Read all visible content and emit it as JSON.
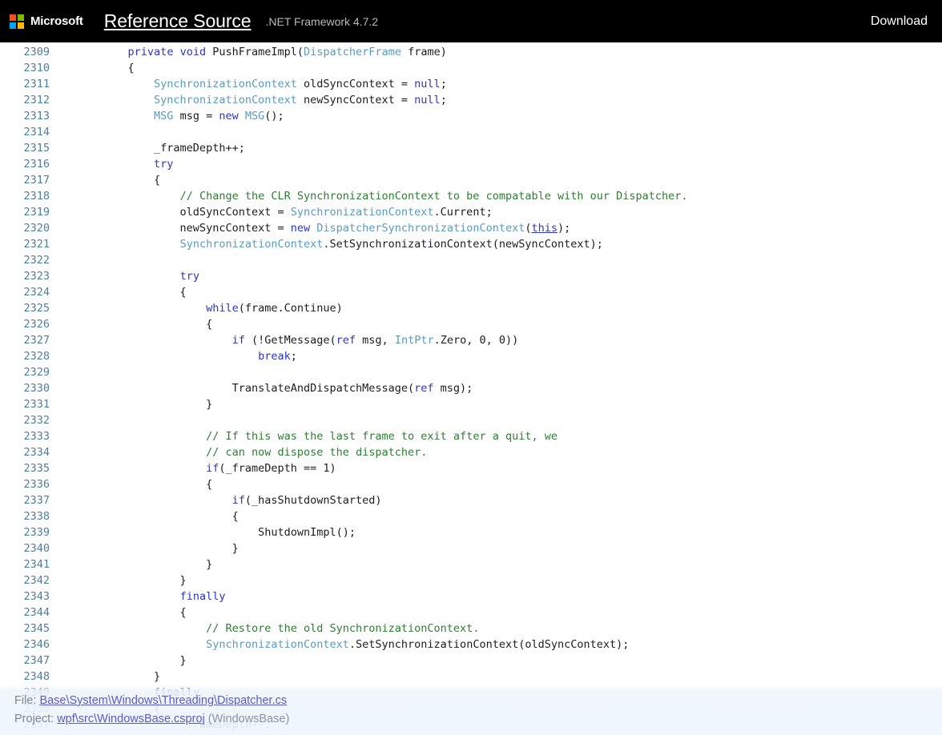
{
  "header": {
    "logo_icon": "microsoft-squares-icon",
    "wordmark": "Microsoft",
    "brand_title": "Reference Source",
    "framework_version": ".NET Framework 4.7.2",
    "download_label": "Download"
  },
  "colors": {
    "header_bg": "#000000",
    "page_bg": "#ffffff",
    "line_number": "#4a7fa0",
    "keyword": "#2b36c4",
    "type": "#5b9bbd",
    "comment": "#2e7d32",
    "plain_text": "#1c1c1c",
    "footer_bg": "#eff5fd",
    "footer_text": "#7d8590",
    "footer_link": "#5a5ad0",
    "ms_red": "#f25022",
    "ms_green": "#7fba00",
    "ms_blue": "#00a4ef",
    "ms_yellow": "#ffb900"
  },
  "code": {
    "language": "csharp",
    "first_line": 2309,
    "last_line": 2351,
    "lines": [
      {
        "n": "2309",
        "tokens": [
          {
            "s": "            ",
            "c": "n"
          },
          {
            "s": "private",
            "c": "k"
          },
          {
            "s": " ",
            "c": "n"
          },
          {
            "s": "void",
            "c": "k"
          },
          {
            "s": " PushFrameImpl(",
            "c": "n"
          },
          {
            "s": "DispatcherFrame",
            "c": "t"
          },
          {
            "s": " frame)",
            "c": "n"
          }
        ]
      },
      {
        "n": "2310",
        "tokens": [
          {
            "s": "            {",
            "c": "n"
          }
        ]
      },
      {
        "n": "2311",
        "tokens": [
          {
            "s": "                ",
            "c": "n"
          },
          {
            "s": "SynchronizationContext",
            "c": "t"
          },
          {
            "s": " oldSyncContext = ",
            "c": "n"
          },
          {
            "s": "null",
            "c": "k"
          },
          {
            "s": ";",
            "c": "n"
          }
        ]
      },
      {
        "n": "2312",
        "tokens": [
          {
            "s": "                ",
            "c": "n"
          },
          {
            "s": "SynchronizationContext",
            "c": "t"
          },
          {
            "s": " newSyncContext = ",
            "c": "n"
          },
          {
            "s": "null",
            "c": "k"
          },
          {
            "s": ";",
            "c": "n"
          }
        ]
      },
      {
        "n": "2313",
        "tokens": [
          {
            "s": "                ",
            "c": "n"
          },
          {
            "s": "MSG",
            "c": "t"
          },
          {
            "s": " msg = ",
            "c": "n"
          },
          {
            "s": "new",
            "c": "k"
          },
          {
            "s": " ",
            "c": "n"
          },
          {
            "s": "MSG",
            "c": "t"
          },
          {
            "s": "();",
            "c": "n"
          }
        ]
      },
      {
        "n": "2314",
        "tokens": [
          {
            "s": "",
            "c": "n"
          }
        ]
      },
      {
        "n": "2315",
        "tokens": [
          {
            "s": "                _frameDepth++;",
            "c": "n"
          }
        ]
      },
      {
        "n": "2316",
        "tokens": [
          {
            "s": "                ",
            "c": "n"
          },
          {
            "s": "try",
            "c": "k"
          }
        ]
      },
      {
        "n": "2317",
        "tokens": [
          {
            "s": "                {",
            "c": "n"
          }
        ]
      },
      {
        "n": "2318",
        "tokens": [
          {
            "s": "                    ",
            "c": "n"
          },
          {
            "s": "// Change the CLR SynchronizationContext to be compatable with our Dispatcher.",
            "c": "c"
          }
        ]
      },
      {
        "n": "2319",
        "tokens": [
          {
            "s": "                    oldSyncContext = ",
            "c": "n"
          },
          {
            "s": "SynchronizationContext",
            "c": "t"
          },
          {
            "s": ".Current;",
            "c": "n"
          }
        ]
      },
      {
        "n": "2320",
        "tokens": [
          {
            "s": "                    newSyncContext = ",
            "c": "n"
          },
          {
            "s": "new",
            "c": "k"
          },
          {
            "s": " ",
            "c": "n"
          },
          {
            "s": "DispatcherSynchronizationContext",
            "c": "t"
          },
          {
            "s": "(",
            "c": "n"
          },
          {
            "s": "this",
            "c": "link"
          },
          {
            "s": ");",
            "c": "n"
          }
        ]
      },
      {
        "n": "2321",
        "tokens": [
          {
            "s": "                    ",
            "c": "n"
          },
          {
            "s": "SynchronizationContext",
            "c": "t"
          },
          {
            "s": ".SetSynchronizationContext(newSyncContext);",
            "c": "n"
          }
        ]
      },
      {
        "n": "2322",
        "tokens": [
          {
            "s": "",
            "c": "n"
          }
        ]
      },
      {
        "n": "2323",
        "tokens": [
          {
            "s": "                    ",
            "c": "n"
          },
          {
            "s": "try",
            "c": "k"
          }
        ]
      },
      {
        "n": "2324",
        "tokens": [
          {
            "s": "                    {",
            "c": "n"
          }
        ]
      },
      {
        "n": "2325",
        "tokens": [
          {
            "s": "                        ",
            "c": "n"
          },
          {
            "s": "while",
            "c": "k"
          },
          {
            "s": "(frame.Continue)",
            "c": "n"
          }
        ]
      },
      {
        "n": "2326",
        "tokens": [
          {
            "s": "                        {",
            "c": "n"
          }
        ]
      },
      {
        "n": "2327",
        "tokens": [
          {
            "s": "                            ",
            "c": "n"
          },
          {
            "s": "if",
            "c": "k"
          },
          {
            "s": " (!GetMessage(",
            "c": "n"
          },
          {
            "s": "ref",
            "c": "k"
          },
          {
            "s": " msg, ",
            "c": "n"
          },
          {
            "s": "IntPtr",
            "c": "t"
          },
          {
            "s": ".Zero, 0, 0))",
            "c": "n"
          }
        ]
      },
      {
        "n": "2328",
        "tokens": [
          {
            "s": "                                ",
            "c": "n"
          },
          {
            "s": "break",
            "c": "k"
          },
          {
            "s": ";",
            "c": "n"
          }
        ]
      },
      {
        "n": "2329",
        "tokens": [
          {
            "s": "",
            "c": "n"
          }
        ]
      },
      {
        "n": "2330",
        "tokens": [
          {
            "s": "                            TranslateAndDispatchMessage(",
            "c": "n"
          },
          {
            "s": "ref",
            "c": "k"
          },
          {
            "s": " msg);",
            "c": "n"
          }
        ]
      },
      {
        "n": "2331",
        "tokens": [
          {
            "s": "                        }",
            "c": "n"
          }
        ]
      },
      {
        "n": "2332",
        "tokens": [
          {
            "s": "",
            "c": "n"
          }
        ]
      },
      {
        "n": "2333",
        "tokens": [
          {
            "s": "                        ",
            "c": "n"
          },
          {
            "s": "// If this was the last frame to exit after a quit, we",
            "c": "c"
          }
        ]
      },
      {
        "n": "2334",
        "tokens": [
          {
            "s": "                        ",
            "c": "n"
          },
          {
            "s": "// can now dispose the dispatcher.",
            "c": "c"
          }
        ]
      },
      {
        "n": "2335",
        "tokens": [
          {
            "s": "                        ",
            "c": "n"
          },
          {
            "s": "if",
            "c": "k"
          },
          {
            "s": "(_frameDepth == 1)",
            "c": "n"
          }
        ]
      },
      {
        "n": "2336",
        "tokens": [
          {
            "s": "                        {",
            "c": "n"
          }
        ]
      },
      {
        "n": "2337",
        "tokens": [
          {
            "s": "                            ",
            "c": "n"
          },
          {
            "s": "if",
            "c": "k"
          },
          {
            "s": "(_hasShutdownStarted)",
            "c": "n"
          }
        ]
      },
      {
        "n": "2338",
        "tokens": [
          {
            "s": "                            {",
            "c": "n"
          }
        ]
      },
      {
        "n": "2339",
        "tokens": [
          {
            "s": "                                ShutdownImpl();",
            "c": "n"
          }
        ]
      },
      {
        "n": "2340",
        "tokens": [
          {
            "s": "                            }",
            "c": "n"
          }
        ]
      },
      {
        "n": "2341",
        "tokens": [
          {
            "s": "                        }",
            "c": "n"
          }
        ]
      },
      {
        "n": "2342",
        "tokens": [
          {
            "s": "                    }",
            "c": "n"
          }
        ]
      },
      {
        "n": "2343",
        "tokens": [
          {
            "s": "                    ",
            "c": "n"
          },
          {
            "s": "finally",
            "c": "k"
          }
        ]
      },
      {
        "n": "2344",
        "tokens": [
          {
            "s": "                    {",
            "c": "n"
          }
        ]
      },
      {
        "n": "2345",
        "tokens": [
          {
            "s": "                        ",
            "c": "n"
          },
          {
            "s": "// Restore the old SynchronizationContext.",
            "c": "c"
          }
        ]
      },
      {
        "n": "2346",
        "tokens": [
          {
            "s": "                        ",
            "c": "n"
          },
          {
            "s": "SynchronizationContext",
            "c": "t"
          },
          {
            "s": ".SetSynchronizationContext(oldSyncContext);",
            "c": "n"
          }
        ]
      },
      {
        "n": "2347",
        "tokens": [
          {
            "s": "                    }",
            "c": "n"
          }
        ]
      },
      {
        "n": "2348",
        "tokens": [
          {
            "s": "                }",
            "c": "n"
          }
        ]
      },
      {
        "n": "2349",
        "tokens": [
          {
            "s": "                ",
            "c": "n"
          },
          {
            "s": "finally",
            "c": "k"
          }
        ]
      },
      {
        "n": "2350",
        "tokens": [
          {
            "s": "                {",
            "c": "n"
          }
        ]
      },
      {
        "n": "2351",
        "tokens": [
          {
            "s": "                    _frameDepth--;",
            "c": "n"
          }
        ]
      }
    ]
  },
  "file_info": {
    "file_label": "File:",
    "file_path": "Base\\System\\Windows\\Threading\\Dispatcher.cs",
    "project_label": "Project:",
    "project_path": "wpf\\src\\WindowsBase.csproj",
    "project_assembly": "(WindowsBase)"
  }
}
